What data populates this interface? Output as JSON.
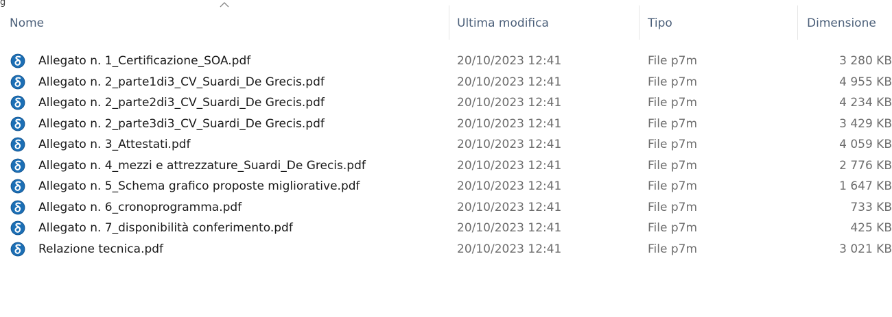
{
  "top_glyph": "g",
  "columns": {
    "name": "Nome",
    "modified": "Ultima modifica",
    "type": "Tipo",
    "size": "Dimensione"
  },
  "sort": {
    "column": "name",
    "direction": "ascending"
  },
  "file_icon": {
    "name": "p7m-signature-icon",
    "color": "#1c6fb5"
  },
  "files": [
    {
      "name": "Allegato n. 1_Certificazione_SOA.pdf",
      "modified": "20/10/2023 12:41",
      "type": "File p7m",
      "size": "3 280 KB"
    },
    {
      "name": "Allegato n. 2_parte1di3_CV_Suardi_De Grecis.pdf",
      "modified": "20/10/2023 12:41",
      "type": "File p7m",
      "size": "4 955 KB"
    },
    {
      "name": "Allegato n. 2_parte2di3_CV_Suardi_De Grecis.pdf",
      "modified": "20/10/2023 12:41",
      "type": "File p7m",
      "size": "4 234 KB"
    },
    {
      "name": "Allegato n. 2_parte3di3_CV_Suardi_De Grecis.pdf",
      "modified": "20/10/2023 12:41",
      "type": "File p7m",
      "size": "3 429 KB"
    },
    {
      "name": "Allegato n. 3_Attestati.pdf",
      "modified": "20/10/2023 12:41",
      "type": "File p7m",
      "size": "4 059 KB"
    },
    {
      "name": "Allegato n. 4_mezzi e attrezzature_Suardi_De Grecis.pdf",
      "modified": "20/10/2023 12:41",
      "type": "File p7m",
      "size": "2 776 KB"
    },
    {
      "name": "Allegato n. 5_Schema grafico proposte migliorative.pdf",
      "modified": "20/10/2023 12:41",
      "type": "File p7m",
      "size": "1 647 KB"
    },
    {
      "name": "Allegato n. 6_cronoprogramma.pdf",
      "modified": "20/10/2023 12:41",
      "type": "File p7m",
      "size": "733 KB"
    },
    {
      "name": "Allegato n. 7_disponibilità conferimento.pdf",
      "modified": "20/10/2023 12:41",
      "type": "File p7m",
      "size": "425 KB"
    },
    {
      "name": "Relazione tecnica.pdf",
      "modified": "20/10/2023 12:41",
      "type": "File p7m",
      "size": "3 021 KB"
    }
  ]
}
